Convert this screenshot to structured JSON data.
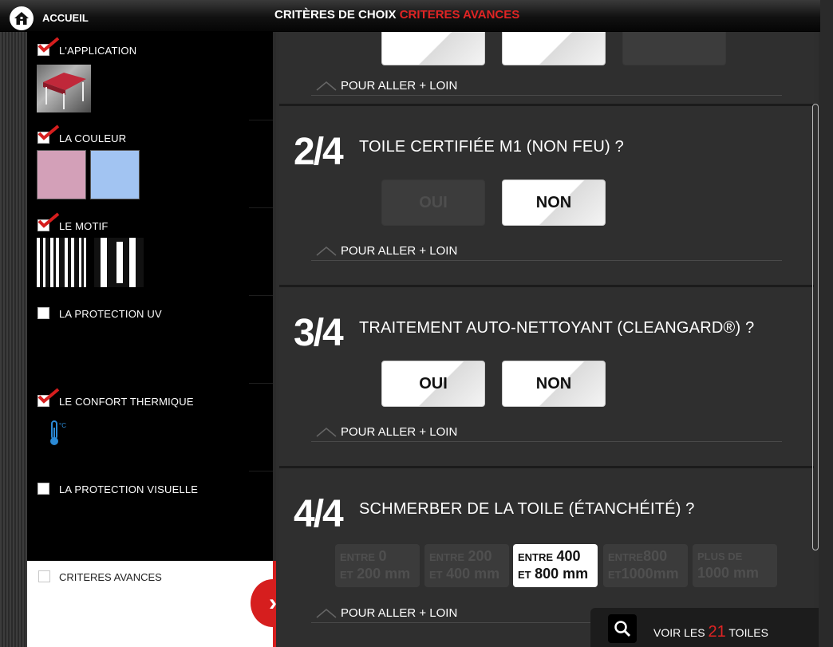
{
  "header": {
    "home_label": "ACCUEIL",
    "crumb_choix": "CRITÈRES DE CHOIX",
    "crumb_avances": "CRITERES AVANCES"
  },
  "sidebar": {
    "application": {
      "label": "L'APPLICATION",
      "checked": true
    },
    "couleur": {
      "label": "LA COULEUR",
      "checked": true,
      "swatches": [
        "#d3a0b8",
        "#a2c4f2"
      ]
    },
    "motif": {
      "label": "LE MOTIF",
      "checked": true
    },
    "protection_uv": {
      "label": "LA PROTECTION UV",
      "checked": false
    },
    "confort_thermique": {
      "label": "LE CONFORT THERMIQUE",
      "checked": true,
      "unit": "°C"
    },
    "protection_visuelle": {
      "label": "LA PROTECTION VISUELLE",
      "checked": false
    },
    "avances": {
      "label": "CRITERES AVANCES",
      "checked": false
    }
  },
  "main": {
    "more_label": "POUR ALLER + LOIN",
    "questions": [
      {
        "num": "2/4",
        "text": "TOILE CERTIFIÉE M1 (NON FEU) ?",
        "oui": "OUI",
        "non": "NON",
        "oui_enabled": false,
        "non_enabled": true
      },
      {
        "num": "3/4",
        "text": "TRAITEMENT AUTO-NETTOYANT (CLEANGARD®) ?",
        "oui": "OUI",
        "non": "NON",
        "oui_enabled": true,
        "non_enabled": true
      },
      {
        "num": "4/4",
        "text": "SCHMERBER DE LA TOILE (ÉTANCHÉITÉ) ?",
        "ranges": [
          {
            "top_small": "ENTRE",
            "top_big": "0",
            "bot_small": "ET",
            "bot_big": "200 mm",
            "enabled": false
          },
          {
            "top_small": "ENTRE",
            "top_big": "200",
            "bot_small": "ET",
            "bot_big": "400 mm",
            "enabled": false
          },
          {
            "top_small": "ENTRE",
            "top_big": "400",
            "bot_small": "ET",
            "bot_big": "800 mm",
            "enabled": true
          },
          {
            "top_small": "ENTRE",
            "top_big": "800",
            "bot_small": "ET",
            "bot_big": "1000mm",
            "enabled": false
          },
          {
            "top_small": "PLUS DE",
            "top_big": "",
            "bot_small": "",
            "bot_big": "1000 mm",
            "enabled": false
          }
        ]
      }
    ]
  },
  "footer": {
    "voir_prefix": "VOIR LES",
    "voir_count": "21",
    "voir_suffix": "TOILES"
  },
  "colors": {
    "accent": "#e02424",
    "panel": "#2f2f2f"
  }
}
